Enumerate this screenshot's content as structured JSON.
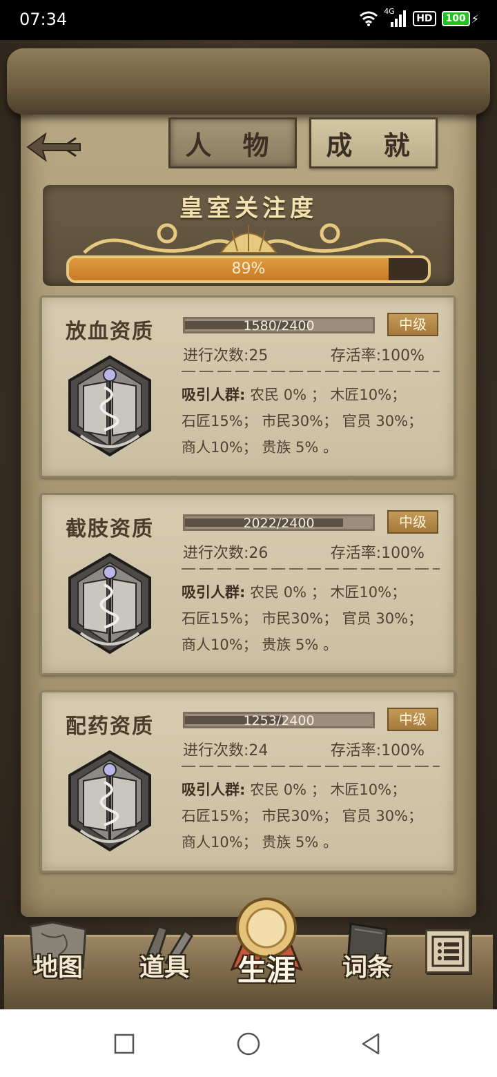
{
  "status_bar": {
    "time": "07:34",
    "network": "4G",
    "hd": "HD",
    "battery": "100"
  },
  "tabs": [
    {
      "label": "人 物",
      "active": true
    },
    {
      "label": "成 就",
      "active": false
    }
  ],
  "royal": {
    "title": "皇室关注度",
    "progress_text": "89%",
    "progress": 0.89
  },
  "cards": [
    {
      "title": "放血资质",
      "progress_text": "1580/2400",
      "progress": 0.658,
      "level": "中级",
      "count": "进行次数:25",
      "survival": "存活率:100%",
      "attract_label": "吸引人群:",
      "attract_line1": " 农民 0% ； 木匠10%；",
      "attract_line2": "石匠15%； 市民30%； 官员 30%；",
      "attract_line3": "商人10%； 贵族 5% 。"
    },
    {
      "title": "截肢资质",
      "progress_text": "2022/2400",
      "progress": 0.843,
      "level": "中级",
      "count": "进行次数:26",
      "survival": "存活率:100%",
      "attract_label": "吸引人群:",
      "attract_line1": " 农民 0% ； 木匠10%；",
      "attract_line2": "石匠15%； 市民30%； 官员 30%；",
      "attract_line3": "商人10%； 贵族 5% 。"
    },
    {
      "title": "配药资质",
      "progress_text": "1253/2400",
      "progress": 0.522,
      "level": "中级",
      "count": "进行次数:24",
      "survival": "存活率:100%",
      "attract_label": "吸引人群:",
      "attract_line1": " 农民 0% ； 木匠10%；",
      "attract_line2": "石匠15%； 市民30%； 官员 30%；",
      "attract_line3": "商人10%； 贵族 5% 。"
    }
  ],
  "bottom_nav": [
    {
      "label": "地图",
      "icon": "map-icon"
    },
    {
      "label": "道具",
      "icon": "items-icon"
    },
    {
      "label": "生涯",
      "icon": "career-medal-icon",
      "active": true
    },
    {
      "label": "词条",
      "icon": "book-icon"
    }
  ],
  "colors": {
    "accent_orange": "#d98c32",
    "parchment": "#b8a883",
    "dark_brown": "#3a3024",
    "badge_gold": "#b88c4a"
  }
}
